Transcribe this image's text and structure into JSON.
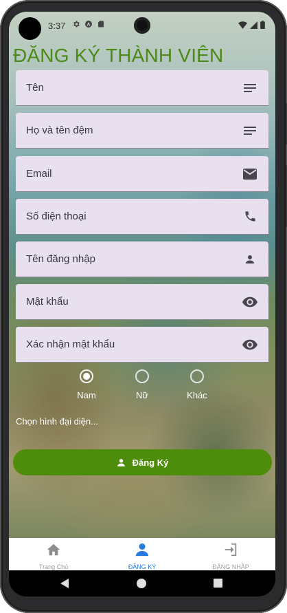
{
  "status_bar": {
    "time": "3:37"
  },
  "page": {
    "title": "ĐĂNG KÝ THÀNH VIÊN"
  },
  "form": {
    "fields": [
      {
        "label": "Tên",
        "icon": "subject-icon"
      },
      {
        "label": "Họ và tên đệm",
        "icon": "subject-icon"
      },
      {
        "label": "Email",
        "icon": "email-icon"
      },
      {
        "label": "Số điện thoại",
        "icon": "phone-icon"
      },
      {
        "label": "Tên đăng nhập",
        "icon": "person-icon"
      },
      {
        "label": "Mật khẩu",
        "icon": "eye-icon"
      },
      {
        "label": "Xác nhận mật khẩu",
        "icon": "eye-icon"
      }
    ],
    "gender": {
      "options": [
        "Nam",
        "Nữ",
        "Khác"
      ],
      "selected": "Nam"
    },
    "avatar_link": "Chọn hình đại diện...",
    "register_button": "Đăng Ký"
  },
  "bottom_nav": {
    "items": [
      {
        "label": "Trang Chủ",
        "icon": "home-icon"
      },
      {
        "label": "ĐĂNG KÝ",
        "icon": "person-icon"
      },
      {
        "label": "ĐĂNG NHẬP",
        "icon": "login-icon"
      }
    ],
    "active": "ĐĂNG KÝ"
  },
  "colors": {
    "accent_green": "#4b8a17",
    "button_green": "#4e8c0c",
    "field_background": "#e8e0ee",
    "active_nav_blue": "#2a7be0"
  }
}
